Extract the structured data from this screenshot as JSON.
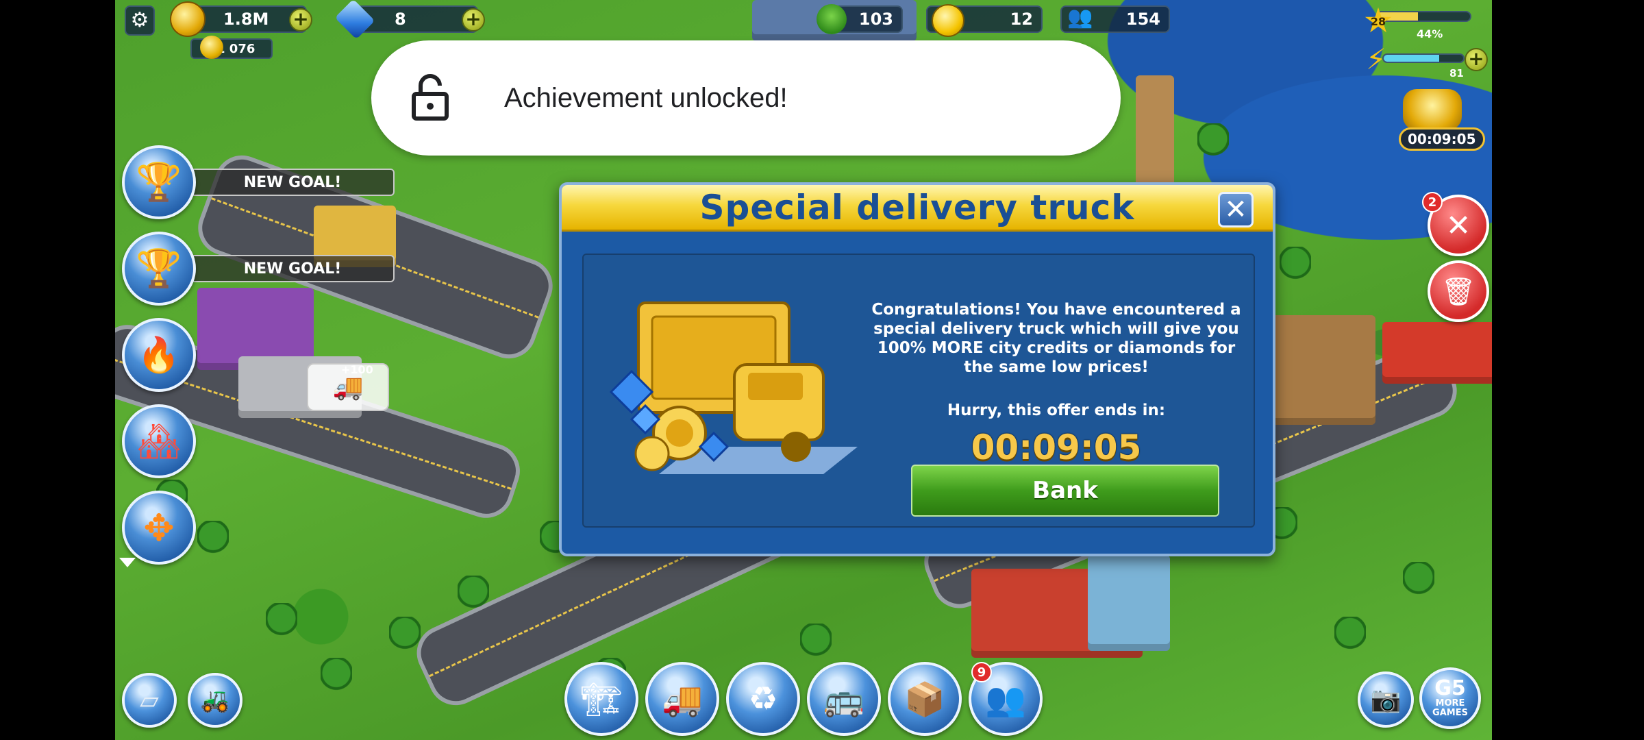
{
  "hud": {
    "coins": "1.8M",
    "gold": "1 076",
    "diamonds": "8",
    "trees": "103",
    "happiness": "12",
    "population": "154",
    "level": "28",
    "xp_percent_label": "44%",
    "xp_progress": 0.44,
    "energy": "81",
    "energy_progress": 0.7,
    "bonus_timer": "00:09:05"
  },
  "toast": {
    "text": "Achievement unlocked!",
    "icon": "lock-open-icon"
  },
  "left_panel": {
    "goal_1": "NEW GOAL!",
    "goal_2": "NEW GOAL!"
  },
  "dialog": {
    "title": "Special delivery truck",
    "message": "Congratulations! You have encountered a special delivery truck which will give you 100% MORE city credits or diamonds for the same low prices!",
    "hurry": "Hurry, this offer ends in:",
    "timer": "00:09:05",
    "bank_label": "Bank"
  },
  "map": {
    "building_bonus": "+100"
  },
  "right_panel": {
    "repair_badge": "2"
  },
  "dock": {
    "social_badge": "9"
  },
  "branding": {
    "more_games": "MORE\nGAMES",
    "g5": "G5"
  },
  "colors": {
    "dialog_bg": "#1c5aa5",
    "header_gold": "#f6d73d",
    "title_blue": "#1a4f95",
    "timer_gold": "#f7c84a",
    "bank_green": "#3f9c1c"
  }
}
